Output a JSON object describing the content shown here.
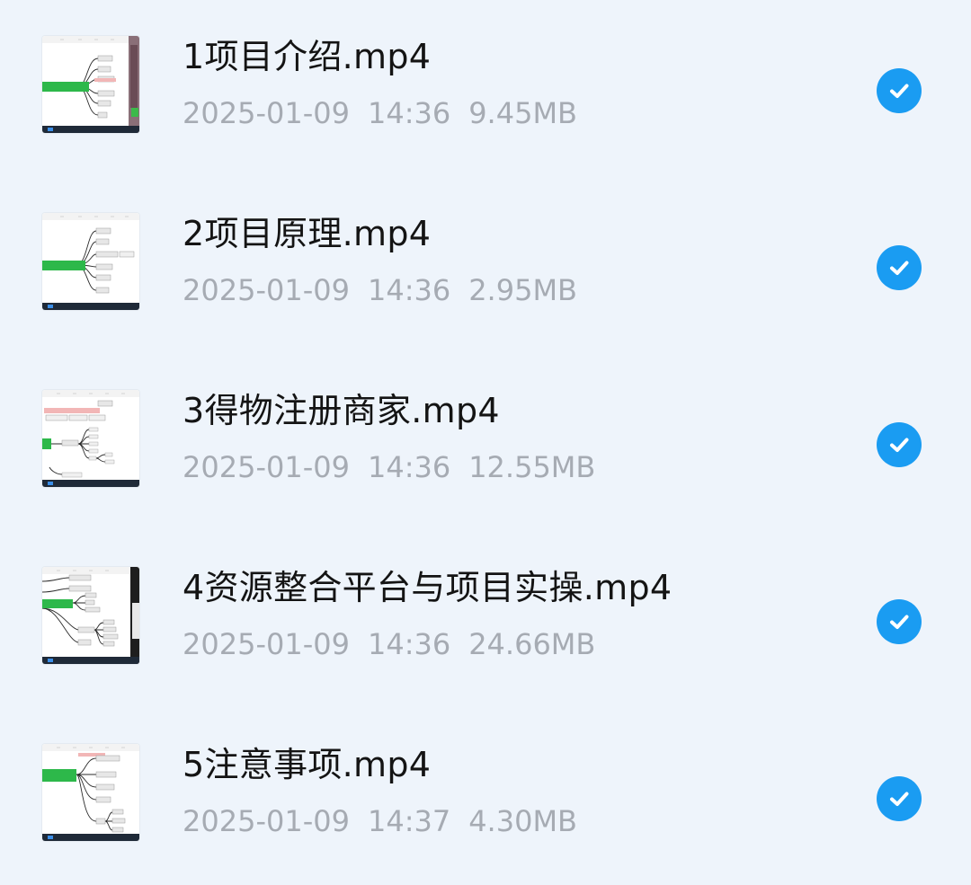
{
  "files": [
    {
      "name": "1项目介绍.mp4",
      "date": "2025-01-09",
      "time": "14:36",
      "size": "9.45MB",
      "selected": true,
      "thumb_variant": "mindmap-a"
    },
    {
      "name": "2项目原理.mp4",
      "date": "2025-01-09",
      "time": "14:36",
      "size": "2.95MB",
      "selected": true,
      "thumb_variant": "mindmap-a"
    },
    {
      "name": "3得物注册商家.mp4",
      "date": "2025-01-09",
      "time": "14:36",
      "size": "12.55MB",
      "selected": true,
      "thumb_variant": "mindmap-b"
    },
    {
      "name": "4资源整合平台与项目实操.mp4",
      "date": "2025-01-09",
      "time": "14:36",
      "size": "24.66MB",
      "selected": true,
      "thumb_variant": "mindmap-c"
    },
    {
      "name": "5注意事项.mp4",
      "date": "2025-01-09",
      "time": "14:37",
      "size": "4.30MB",
      "selected": true,
      "thumb_variant": "mindmap-d"
    }
  ],
  "colors": {
    "background": "#eef4fb",
    "title": "#141414",
    "meta": "#a6abb3",
    "check": "#1a9cf2",
    "thumb_green": "#2db84a"
  },
  "icons": {
    "selected": "check-circle-icon"
  }
}
